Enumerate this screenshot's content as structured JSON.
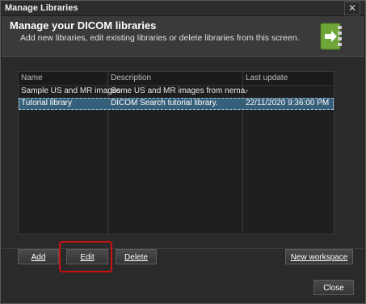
{
  "window": {
    "title": "Manage Libraries",
    "close_glyph": "✕"
  },
  "header": {
    "title": "Manage your DICOM libraries",
    "subtitle": "Add new libraries, edit existing libraries or delete libraries from this screen.",
    "icon": "book-arrow-icon",
    "icon_color": "#6fa63a"
  },
  "table": {
    "columns": [
      "Name",
      "Description",
      "Last update"
    ],
    "rows": [
      {
        "name": "Sample US and MR images",
        "description": "Some US and MR images from nema.",
        "last_update": "-"
      },
      {
        "name": "Tutorial library",
        "description": "DICOM Search tutorial library.",
        "last_update": "22/11/2020 9:36:00 PM"
      }
    ],
    "selected_row": 1,
    "selection_color": "#365f7a"
  },
  "buttons": {
    "add": "Add",
    "edit": "Edit",
    "delete": "Delete",
    "new_workspace": "New workspace",
    "close": "Close"
  },
  "annotation": {
    "highlight_color": "#cc1111",
    "highlighted": "edit"
  }
}
